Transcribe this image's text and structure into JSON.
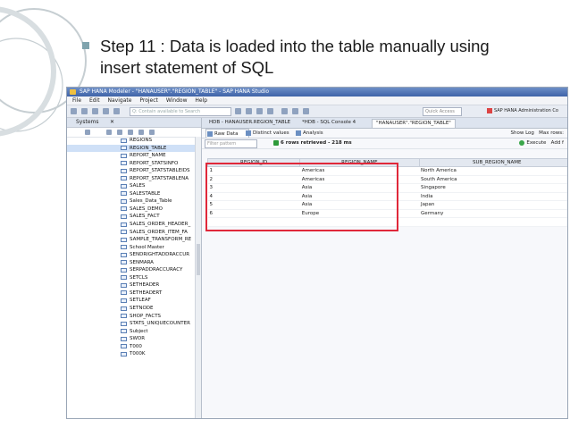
{
  "slide": {
    "text_line1": "Step 11 : Data is loaded into the table manually using",
    "text_line2": "insert statement of SQL"
  },
  "window": {
    "title": "SAP HANA Modeler - \"HANAUSER\".\"REGION_TABLE\" - SAP HANA Studio",
    "menu": [
      "File",
      "Edit",
      "Navigate",
      "Project",
      "Window",
      "Help"
    ],
    "search_placeholder": "Q: Contain available to Search",
    "quick_access": "Quick Access",
    "perspective": "SAP HANA Administration Co"
  },
  "left_panel": {
    "tab": "Systems",
    "tree": [
      "REGIONS",
      "REGION_TABLE",
      "REPORT_NAME",
      "REPORT_STATSINFO",
      "REPORT_STATSTABLEIDS",
      "REPORT_STATSTABLENA",
      "SALES",
      "SALESTABLE",
      "Sales_Data_Table",
      "SALES_DEMO",
      "SALES_FACT",
      "SALES_ORDER_HEADER_",
      "SALES_ORDER_ITEM_FA",
      "SAMPLE_TRANSFORM_RE",
      "School Master",
      "SENDRIGHTADDRACCUR",
      "SENMARA",
      "SERPADDRACCURACY",
      "SETCLS",
      "SETHEADER",
      "SETHEADERT",
      "SETLEAF",
      "SETNODE",
      "SHOP_FACTS",
      "STATS_UNIQUECOUNTER",
      "Subject",
      "SWOR",
      "T000",
      "T000K"
    ],
    "selected_index": 1
  },
  "editor": {
    "tabs": [
      "HDB - HANAUSER.REGION_TABLE",
      "*HDB - SQL Console 4",
      "\"HANAUSER\".\"REGION_TABLE\""
    ],
    "active_tab_index": 2,
    "sub_tabs": [
      "Raw Data",
      "Distinct values",
      "Analysis"
    ],
    "show_log": "Show Log",
    "max_rows": "Max rows:",
    "filter_placeholder": "Filter pattern",
    "rows_retrieved": "6 rows retrieved - 218 ms",
    "execute": "Execute",
    "add": "Add f"
  },
  "table": {
    "columns": [
      "REGION_ID",
      "REGION_NAME",
      "SUB_REGION_NAME"
    ],
    "rows": [
      [
        "1",
        "Americas",
        "North America"
      ],
      [
        "2",
        "Americas",
        "South America"
      ],
      [
        "3",
        "Asia",
        "Singapore"
      ],
      [
        "4",
        "Asia",
        "India"
      ],
      [
        "5",
        "Asia",
        "Japan"
      ],
      [
        "6",
        "Europe",
        "Germany"
      ]
    ]
  },
  "colors": {
    "highlight": "#e0283a",
    "bullet": "#7fa3ad",
    "decor": "#b8c3c7"
  }
}
